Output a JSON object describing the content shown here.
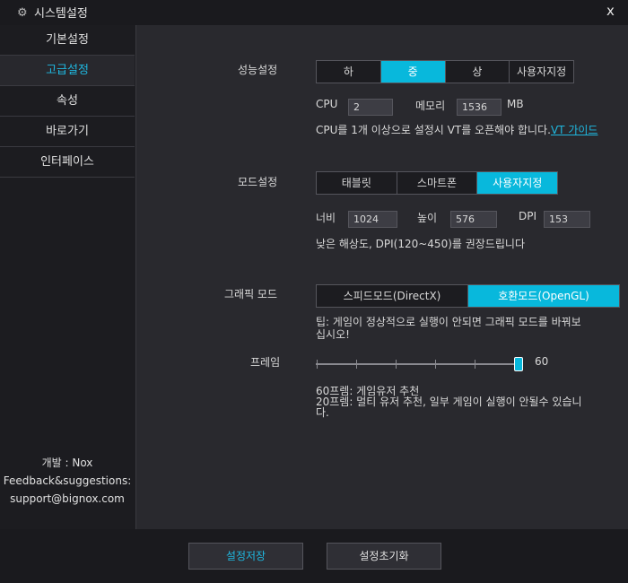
{
  "window": {
    "title": "시스템설정",
    "close": "x"
  },
  "sidebar": {
    "items": [
      {
        "label": "기본설정"
      },
      {
        "label": "고급설정"
      },
      {
        "label": "속성"
      },
      {
        "label": "바로가기"
      },
      {
        "label": "인터페이스"
      }
    ],
    "active_index": 1,
    "footer": {
      "developer": "개발 : Nox",
      "feedback": "Feedback&suggestions:",
      "email": "support@bignox.com"
    }
  },
  "performance": {
    "label": "성능설정",
    "options": [
      "하",
      "중",
      "상",
      "사용자지정"
    ],
    "selected": "중",
    "cpu_label": "CPU",
    "cpu_value": "2",
    "memory_label": "메모리",
    "memory_value": "1536",
    "memory_unit": "MB",
    "note": "CPU를 1개 이상으로 설정시 VT를 오픈해야 합니다.",
    "vt_link": "VT 가이드"
  },
  "mode": {
    "label": "모드설정",
    "options": [
      "태블릿",
      "스마트폰",
      "사용자지정"
    ],
    "selected": "사용자지정",
    "width_label": "너비",
    "width_value": "1024",
    "height_label": "높이",
    "height_value": "576",
    "dpi_label": "DPI",
    "dpi_value": "153",
    "note": "낮은 해상도, DPI(120~450)를 권장드립니다"
  },
  "graphics": {
    "label": "그래픽 모드",
    "options": [
      "스피드모드(DirectX)",
      "호환모드(OpenGL)"
    ],
    "selected": "호환모드(OpenGL)",
    "tip_line1": "팁: 게임이 정상적으로 실행이 안되면 그래픽 모드를 바꿔보",
    "tip_line2": "십시오!"
  },
  "frame": {
    "label": "프레임",
    "value": "60",
    "level_fraction": 1.0,
    "note_line1": "60프렘: 게임유저 추천",
    "note_line2": "20프렘: 멀티 유저 추천, 일부 게임이 실행이 안될수 있습니",
    "note_line3": "다."
  },
  "buttons": {
    "save": "설정저장",
    "reset": "설정초기화"
  },
  "colors": {
    "accent": "#08b8dc",
    "link": "#1fb8e0"
  },
  "icons": {
    "title": "gear-icon",
    "close": "close-icon"
  }
}
